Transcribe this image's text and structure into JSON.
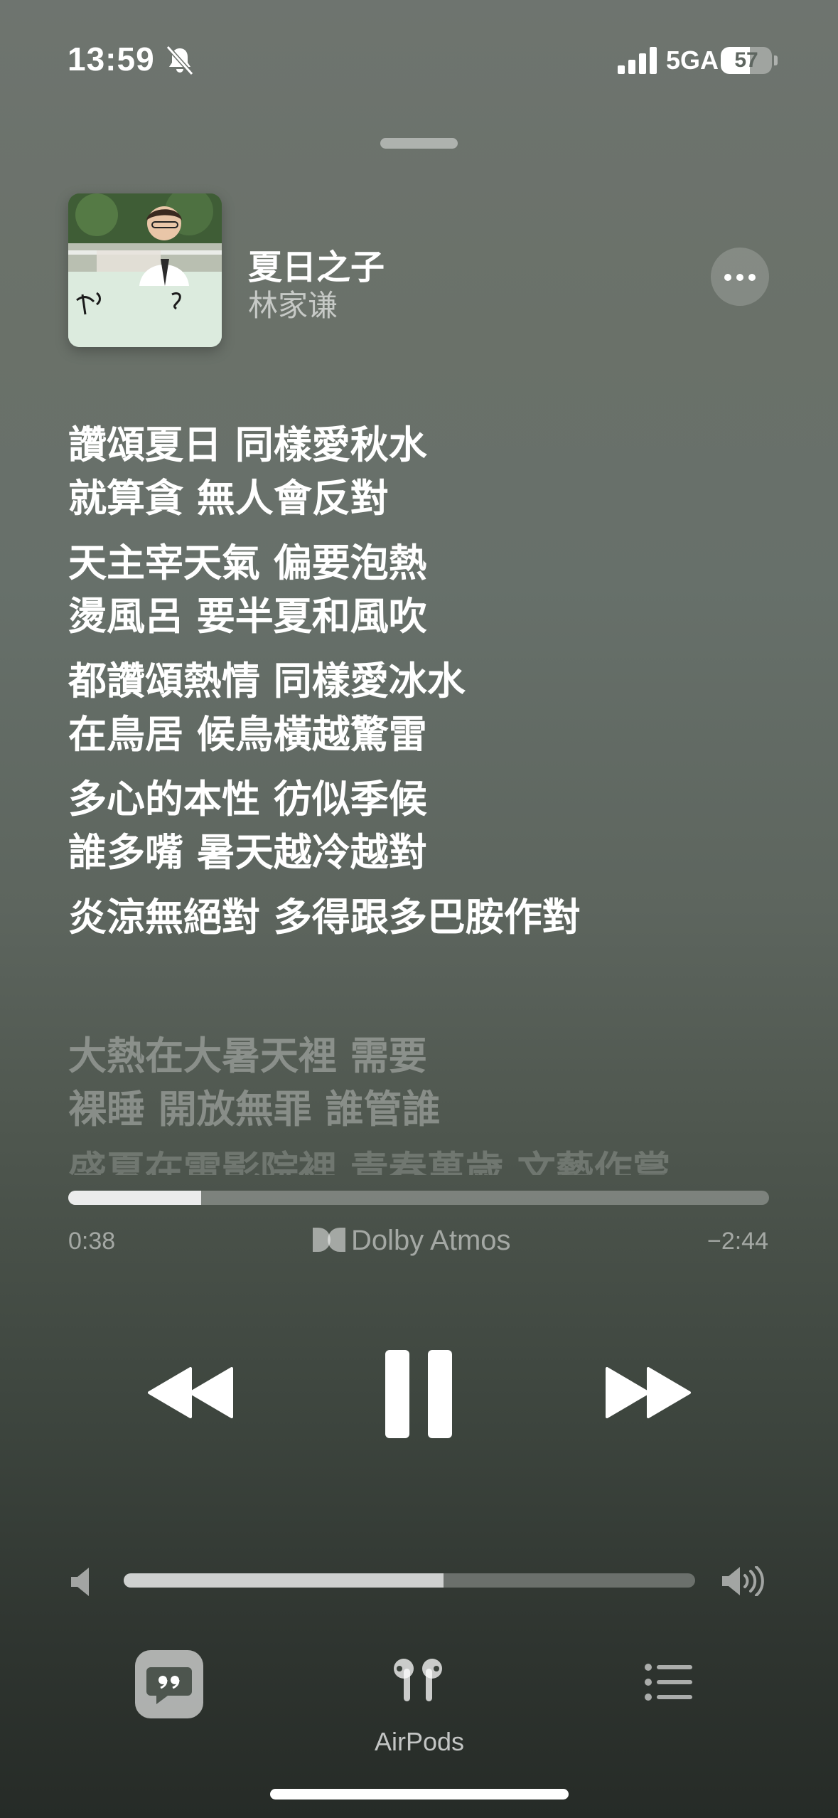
{
  "status_bar": {
    "time": "13:59",
    "silent_icon": "bell-slash-icon",
    "network": "5GA",
    "battery_level": "57",
    "battery_fraction": 0.57
  },
  "now_playing": {
    "title": "夏日之子",
    "artist": "林家谦",
    "artwork_icon": "album-artwork",
    "more_icon": "ellipsis-icon"
  },
  "lyrics": {
    "current": [
      [
        "讚頌夏日 同樣愛秋水",
        "就算貪 無人會反對"
      ],
      [
        "天主宰天氣 偏要泡熱",
        "燙風呂 要半夏和風吹"
      ],
      [
        "都讚頌熱情 同樣愛冰水",
        "在鳥居 候鳥橫越驚雷"
      ],
      [
        "多心的本性 彷似季候",
        "誰多嘴 暑天越冷越對"
      ],
      [
        "炎涼無絕對 多得跟多巴胺作對"
      ]
    ],
    "upcoming": [
      [
        "大熱在大暑天裡 需要",
        "裸睡 開放無罪 誰管誰"
      ]
    ],
    "fading": "盛夏在電影院裡 青春萬歲 文藝作嘗"
  },
  "playback": {
    "elapsed": "0:38",
    "remaining": "−2:44",
    "progress_fraction": 0.19,
    "format_label": "Dolby Atmos"
  },
  "controls": {
    "rewind_icon": "backward-icon",
    "pause_icon": "pause-icon",
    "forward_icon": "forward-icon"
  },
  "volume": {
    "level_fraction": 0.56,
    "min_icon": "speaker-icon",
    "max_icon": "speaker-wave-icon"
  },
  "bottom_bar": {
    "lyrics_icon": "quote-bubble-icon",
    "airpods_label": "AirPods",
    "airpods_icon": "airpods-icon",
    "queue_icon": "list-bullet-icon"
  }
}
